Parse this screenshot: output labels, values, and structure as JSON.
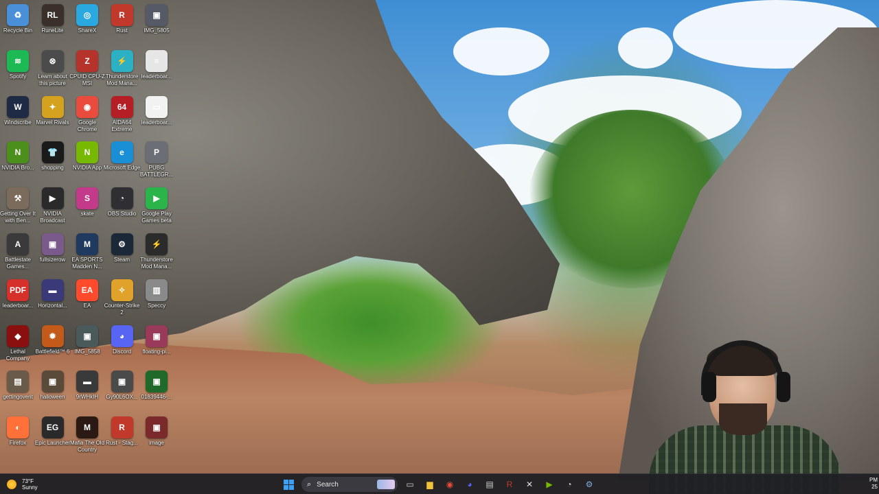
{
  "desktop": {
    "icons": [
      {
        "label": "Recycle Bin",
        "icon": "recycle-bin-icon",
        "color": "#4a90d9",
        "glyph": "♻"
      },
      {
        "label": "RuneLite",
        "icon": "runelite-icon",
        "color": "#3b2f2a",
        "glyph": "RL"
      },
      {
        "label": "ShareX",
        "icon": "sharex-icon",
        "color": "#2aa8e0",
        "glyph": "◎"
      },
      {
        "label": "Rust",
        "icon": "rust-icon",
        "color": "#c0392b",
        "glyph": "R"
      },
      {
        "label": "IMG_5805",
        "icon": "image-file-icon",
        "color": "#555a66",
        "glyph": "▣"
      },
      {
        "label": "Spotify",
        "icon": "spotify-icon",
        "color": "#1db954",
        "glyph": "≋"
      },
      {
        "label": "Learn about this picture",
        "icon": "learn-picture-icon",
        "color": "#4b4b4b",
        "glyph": "⊗"
      },
      {
        "label": "CPUID CPU-Z MSI",
        "icon": "cpuz-icon",
        "color": "#b5332b",
        "glyph": "Z"
      },
      {
        "label": "Thunderstore Mod Mana...",
        "icon": "thunderstore-icon",
        "color": "#2bb0c4",
        "glyph": "⚡"
      },
      {
        "label": "leaderboar...",
        "icon": "document-icon",
        "color": "#e6e6e6",
        "glyph": "≡"
      },
      {
        "label": "Windscribe",
        "icon": "windscribe-icon",
        "color": "#1f2a44",
        "glyph": "W"
      },
      {
        "label": "Marvel Rivals",
        "icon": "marvel-rivals-icon",
        "color": "#d4a21f",
        "glyph": "✦"
      },
      {
        "label": "Google Chrome",
        "icon": "chrome-icon",
        "color": "#e94b3c",
        "glyph": "◉"
      },
      {
        "label": "AIDA64 Extreme",
        "icon": "aida64-icon",
        "color": "#b51e24",
        "glyph": "64"
      },
      {
        "label": "leaderboar...",
        "icon": "document-icon",
        "color": "#f2f2f2",
        "glyph": "▭"
      },
      {
        "label": "NVIDIA Bro...",
        "icon": "nvidia-icon",
        "color": "#4d8f1c",
        "glyph": "N"
      },
      {
        "label": "shopping",
        "icon": "shopping-icon",
        "color": "#1a1a1a",
        "glyph": "👕"
      },
      {
        "label": "NVIDIA App",
        "icon": "nvidia-app-icon",
        "color": "#76b900",
        "glyph": "N"
      },
      {
        "label": "Microsoft Edge",
        "icon": "edge-icon",
        "color": "#1b8fd6",
        "glyph": "e"
      },
      {
        "label": "PUBG BATTLEGR...",
        "icon": "pubg-icon",
        "color": "#6b6e74",
        "glyph": "P"
      },
      {
        "label": "Getting Over It with Ben...",
        "icon": "getting-over-it-icon",
        "color": "#7b6b5a",
        "glyph": "⚒"
      },
      {
        "label": "NVIDIA Broadcast",
        "icon": "nvidia-broadcast-icon",
        "color": "#2a2a2a",
        "glyph": "▶"
      },
      {
        "label": "skate",
        "icon": "skate-icon",
        "color": "#c33a8a",
        "glyph": "S"
      },
      {
        "label": "OBS Studio",
        "icon": "obs-icon",
        "color": "#2e2e33",
        "glyph": "◔"
      },
      {
        "label": "Google Play Games beta",
        "icon": "google-play-games-icon",
        "color": "#2ab44a",
        "glyph": "▶"
      },
      {
        "label": "Battlestate Games...",
        "icon": "battlestate-icon",
        "color": "#3a3a3a",
        "glyph": "A"
      },
      {
        "label": "fullsizerow",
        "icon": "image-file-icon",
        "color": "#7a5a8a",
        "glyph": "▣"
      },
      {
        "label": "EA SPORTS Madden N...",
        "icon": "madden-icon",
        "color": "#1f3a5e",
        "glyph": "M"
      },
      {
        "label": "Steam",
        "icon": "steam-icon",
        "color": "#1b2838",
        "glyph": "⚙"
      },
      {
        "label": "Thunderstore Mod Mana...",
        "icon": "thunderstore-icon",
        "color": "#2b2b2b",
        "glyph": "⚡"
      },
      {
        "label": "leaderboar...",
        "icon": "pdf-icon",
        "color": "#d6302a",
        "glyph": "PDF"
      },
      {
        "label": "Horizontal...",
        "icon": "image-file-icon",
        "color": "#3a3a7a",
        "glyph": "▬"
      },
      {
        "label": "EA",
        "icon": "ea-icon",
        "color": "#ff4b2b",
        "glyph": "EA"
      },
      {
        "label": "Counter-Strike 2",
        "icon": "counter-strike-icon",
        "color": "#e0a22a",
        "glyph": "✧"
      },
      {
        "label": "Speccy",
        "icon": "speccy-icon",
        "color": "#8a8a8a",
        "glyph": "▥"
      },
      {
        "label": "Lethal Company",
        "icon": "lethal-company-icon",
        "color": "#8a1010",
        "glyph": "◆"
      },
      {
        "label": "Battlefield™ 6",
        "icon": "battlefield-icon",
        "color": "#c45a1a",
        "glyph": "✹"
      },
      {
        "label": "IMG_5858",
        "icon": "image-file-icon",
        "color": "#4a5a5a",
        "glyph": "▣"
      },
      {
        "label": "Discord",
        "icon": "discord-icon",
        "color": "#5865f2",
        "glyph": "◕"
      },
      {
        "label": "floating-pi...",
        "icon": "image-file-icon",
        "color": "#9a3a5a",
        "glyph": "▣"
      },
      {
        "label": "gettingoverit",
        "icon": "folder-icon",
        "color": "#6a5a4a",
        "glyph": "▤"
      },
      {
        "label": "halloween",
        "icon": "image-file-icon",
        "color": "#5a4a3a",
        "glyph": "▣"
      },
      {
        "label": "9rWHkIH",
        "icon": "image-file-icon",
        "color": "#3a3a3a",
        "glyph": "▬"
      },
      {
        "label": "Gy90L6OX...",
        "icon": "image-file-icon",
        "color": "#4a4a4a",
        "glyph": "▣"
      },
      {
        "label": "01839446-...",
        "icon": "image-file-icon",
        "color": "#1f6a2a",
        "glyph": "▣"
      },
      {
        "label": "Firefox",
        "icon": "firefox-icon",
        "color": "#ff7139",
        "glyph": "◐"
      },
      {
        "label": "Epic Launcher",
        "icon": "epic-launcher-icon",
        "color": "#2a2a2a",
        "glyph": "EG"
      },
      {
        "label": "Mafia The Old Country",
        "icon": "mafia-icon",
        "color": "#2b1a14",
        "glyph": "M"
      },
      {
        "label": "Rust - Stag...",
        "icon": "rust-icon",
        "color": "#c0392b",
        "glyph": "R"
      },
      {
        "label": "image",
        "icon": "image-file-icon",
        "color": "#7a2a2a",
        "glyph": "▣"
      }
    ]
  },
  "taskbar": {
    "weather": {
      "temp": "73°F",
      "condition": "Sunny"
    },
    "search_placeholder": "Search",
    "apps": [
      {
        "icon": "task-view-icon",
        "glyph": "▭",
        "color": "#cfcfcf"
      },
      {
        "icon": "file-explorer-icon",
        "glyph": "▆",
        "color": "#f2c13a"
      },
      {
        "icon": "chrome-icon",
        "glyph": "◉",
        "color": "#e94b3c"
      },
      {
        "icon": "discord-icon",
        "glyph": "◕",
        "color": "#5865f2"
      },
      {
        "icon": "terminal-icon",
        "glyph": "▤",
        "color": "#cfcfcf"
      },
      {
        "icon": "rust-icon",
        "glyph": "R",
        "color": "#c0392b"
      },
      {
        "icon": "epic-launcher-icon",
        "glyph": "✕",
        "color": "#e0e0e0"
      },
      {
        "icon": "nvidia-broadcast-icon",
        "glyph": "▶",
        "color": "#76b900"
      },
      {
        "icon": "obs-icon",
        "glyph": "◔",
        "color": "#cfcfcf"
      },
      {
        "icon": "steam-icon",
        "glyph": "⚙",
        "color": "#7fb0e0"
      }
    ],
    "clock_time": "PM",
    "clock_date": "25"
  }
}
